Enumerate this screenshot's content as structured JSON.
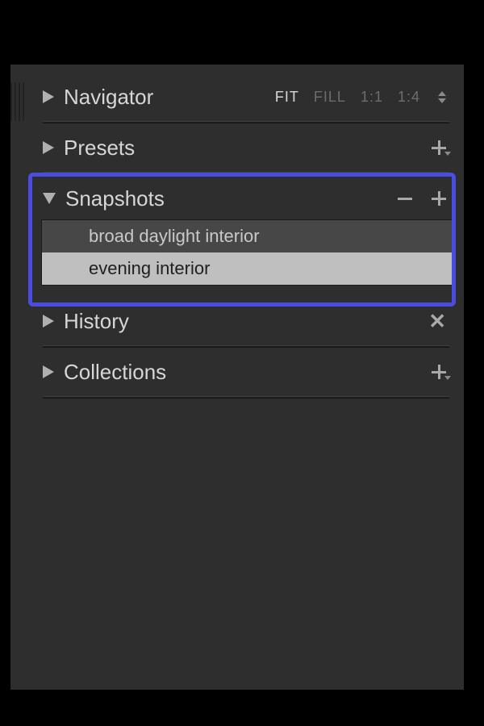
{
  "panels": {
    "navigator": {
      "title": "Navigator",
      "expanded": false,
      "zoom_options": {
        "fit": "FIT",
        "fill": "FILL",
        "r1_1": "1:1",
        "r1_4": "1:4",
        "active": "fit"
      }
    },
    "presets": {
      "title": "Presets",
      "expanded": false
    },
    "snapshots": {
      "title": "Snapshots",
      "expanded": true,
      "items": [
        {
          "label": "broad daylight interior",
          "selected": false
        },
        {
          "label": "evening interior",
          "selected": true
        }
      ]
    },
    "history": {
      "title": "History",
      "expanded": false
    },
    "collections": {
      "title": "Collections",
      "expanded": false
    }
  },
  "highlight": {
    "target": "snapshots",
    "color": "#4b4de0"
  }
}
